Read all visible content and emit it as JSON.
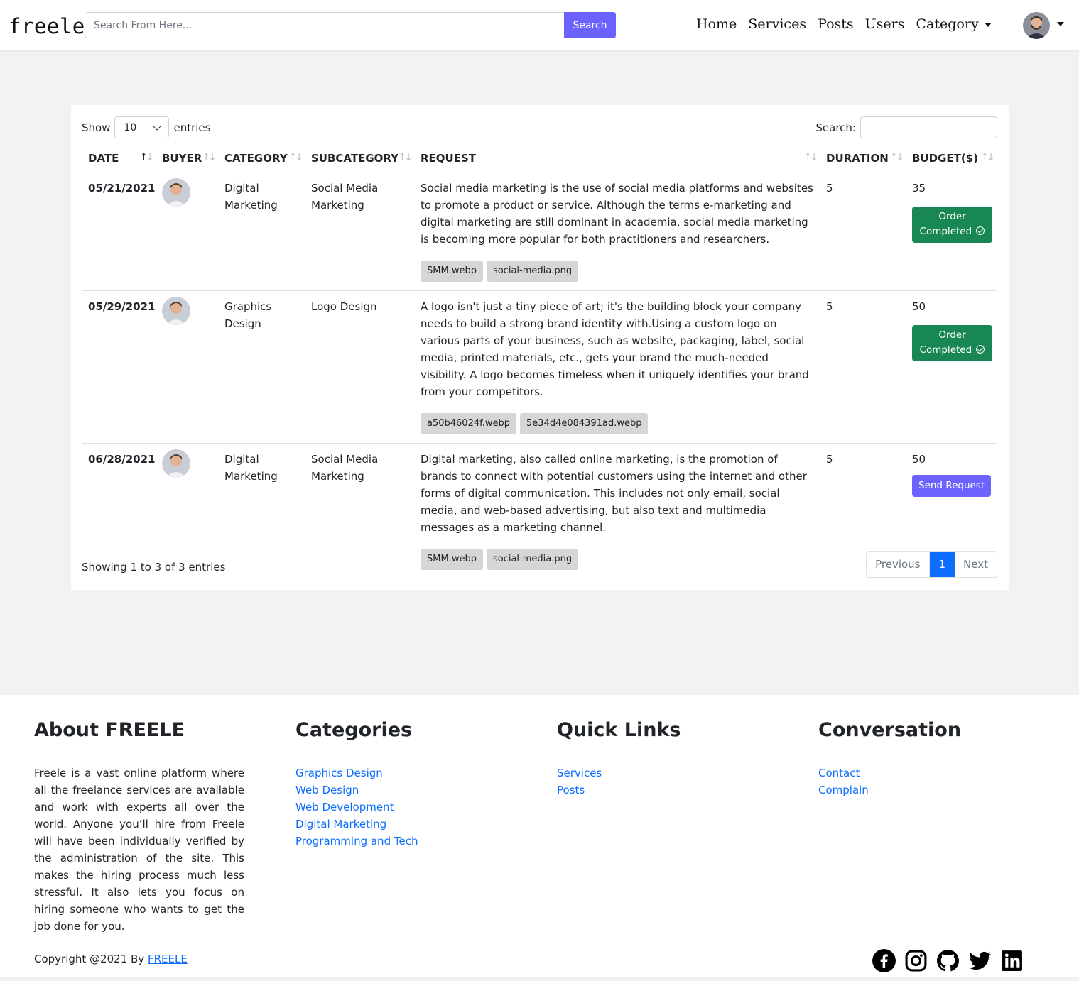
{
  "navbar": {
    "brand": "freele",
    "search_placeholder": "Search From Here...",
    "search_button": "Search",
    "links": [
      "Home",
      "Services",
      "Posts",
      "Users",
      "Category"
    ]
  },
  "table_controls": {
    "show_label": "Show",
    "page_size": "10",
    "entries_label": "entries",
    "search_label": "Search:"
  },
  "columns": [
    "DATE",
    "BUYER",
    "CATEGORY",
    "SUBCATEGORY",
    "REQUEST",
    "DURATION",
    "BUDGET($)"
  ],
  "rows": [
    {
      "date": "05/21/2021",
      "category": "Digital Marketing",
      "subcategory": "Social Media Marketing",
      "request": "Social media marketing is the use of social media platforms and websites to promote a product or service. Although the terms e-marketing and digital marketing are still dominant in academia, social media marketing is becoming more popular for both practitioners and researchers.",
      "files": [
        "SMM.webp",
        "social-media.png"
      ],
      "duration": "5",
      "budget": "35",
      "status": "Order Completed"
    },
    {
      "date": "05/29/2021",
      "category": "Graphics Design",
      "subcategory": "Logo Design",
      "request": "A logo isn't just a tiny piece of art; it's the building block your company needs to build a strong brand identity with.Using a custom logo on various parts of your business, such as website, packaging, label, social media, printed materials, etc., gets your brand the much-needed visibility. A logo becomes timeless when it uniquely identifies your brand from your competitors.",
      "files": [
        "a50b46024f.webp",
        "5e34d4e084391ad.webp"
      ],
      "duration": "5",
      "budget": "50",
      "status": "Order Completed"
    },
    {
      "date": "06/28/2021",
      "category": "Digital Marketing",
      "subcategory": "Social Media Marketing",
      "request": "Digital marketing, also called online marketing, is the promotion of brands to connect with potential customers using the internet and other forms of digital communication. This includes not only email, social media, and web-based advertising, but also text and multimedia messages as a marketing channel.",
      "files": [
        "SMM.webp",
        "social-media.png"
      ],
      "duration": "5",
      "budget": "50",
      "status": "Send Request"
    }
  ],
  "table_footer": {
    "info": "Showing 1 to 3 of 3 entries",
    "previous": "Previous",
    "page": "1",
    "next": "Next"
  },
  "footer": {
    "about_title": "About FREELE",
    "about_text": "Freele is a vast online platform where all the freelance services are available and work with experts all over the world. Anyone you’ll hire from Freele will have been individually verified by the administration of the site. This makes the hiring process much less stressful. It also lets you focus on hiring someone who wants to get the job done for you.",
    "categories_title": "Categories",
    "categories": [
      "Graphics Design",
      "Web Design",
      "Web Development",
      "Digital Marketing",
      "Programming and Tech"
    ],
    "quick_links_title": "Quick Links",
    "quick_links": [
      "Services",
      "Posts"
    ],
    "conversation_title": "Conversation",
    "conversation_links": [
      "Contact",
      "Complain"
    ],
    "copyright_prefix": "Copyright @2021 By",
    "copyright_link": "FREELE",
    "socials": [
      "facebook-icon",
      "instagram-icon",
      "github-icon",
      "twitter-icon",
      "linkedin-icon"
    ]
  },
  "colors": {
    "accent": "#6c63ff",
    "success": "#198754",
    "link": "#0d6efd",
    "page_bg": "#f2f2f2"
  }
}
